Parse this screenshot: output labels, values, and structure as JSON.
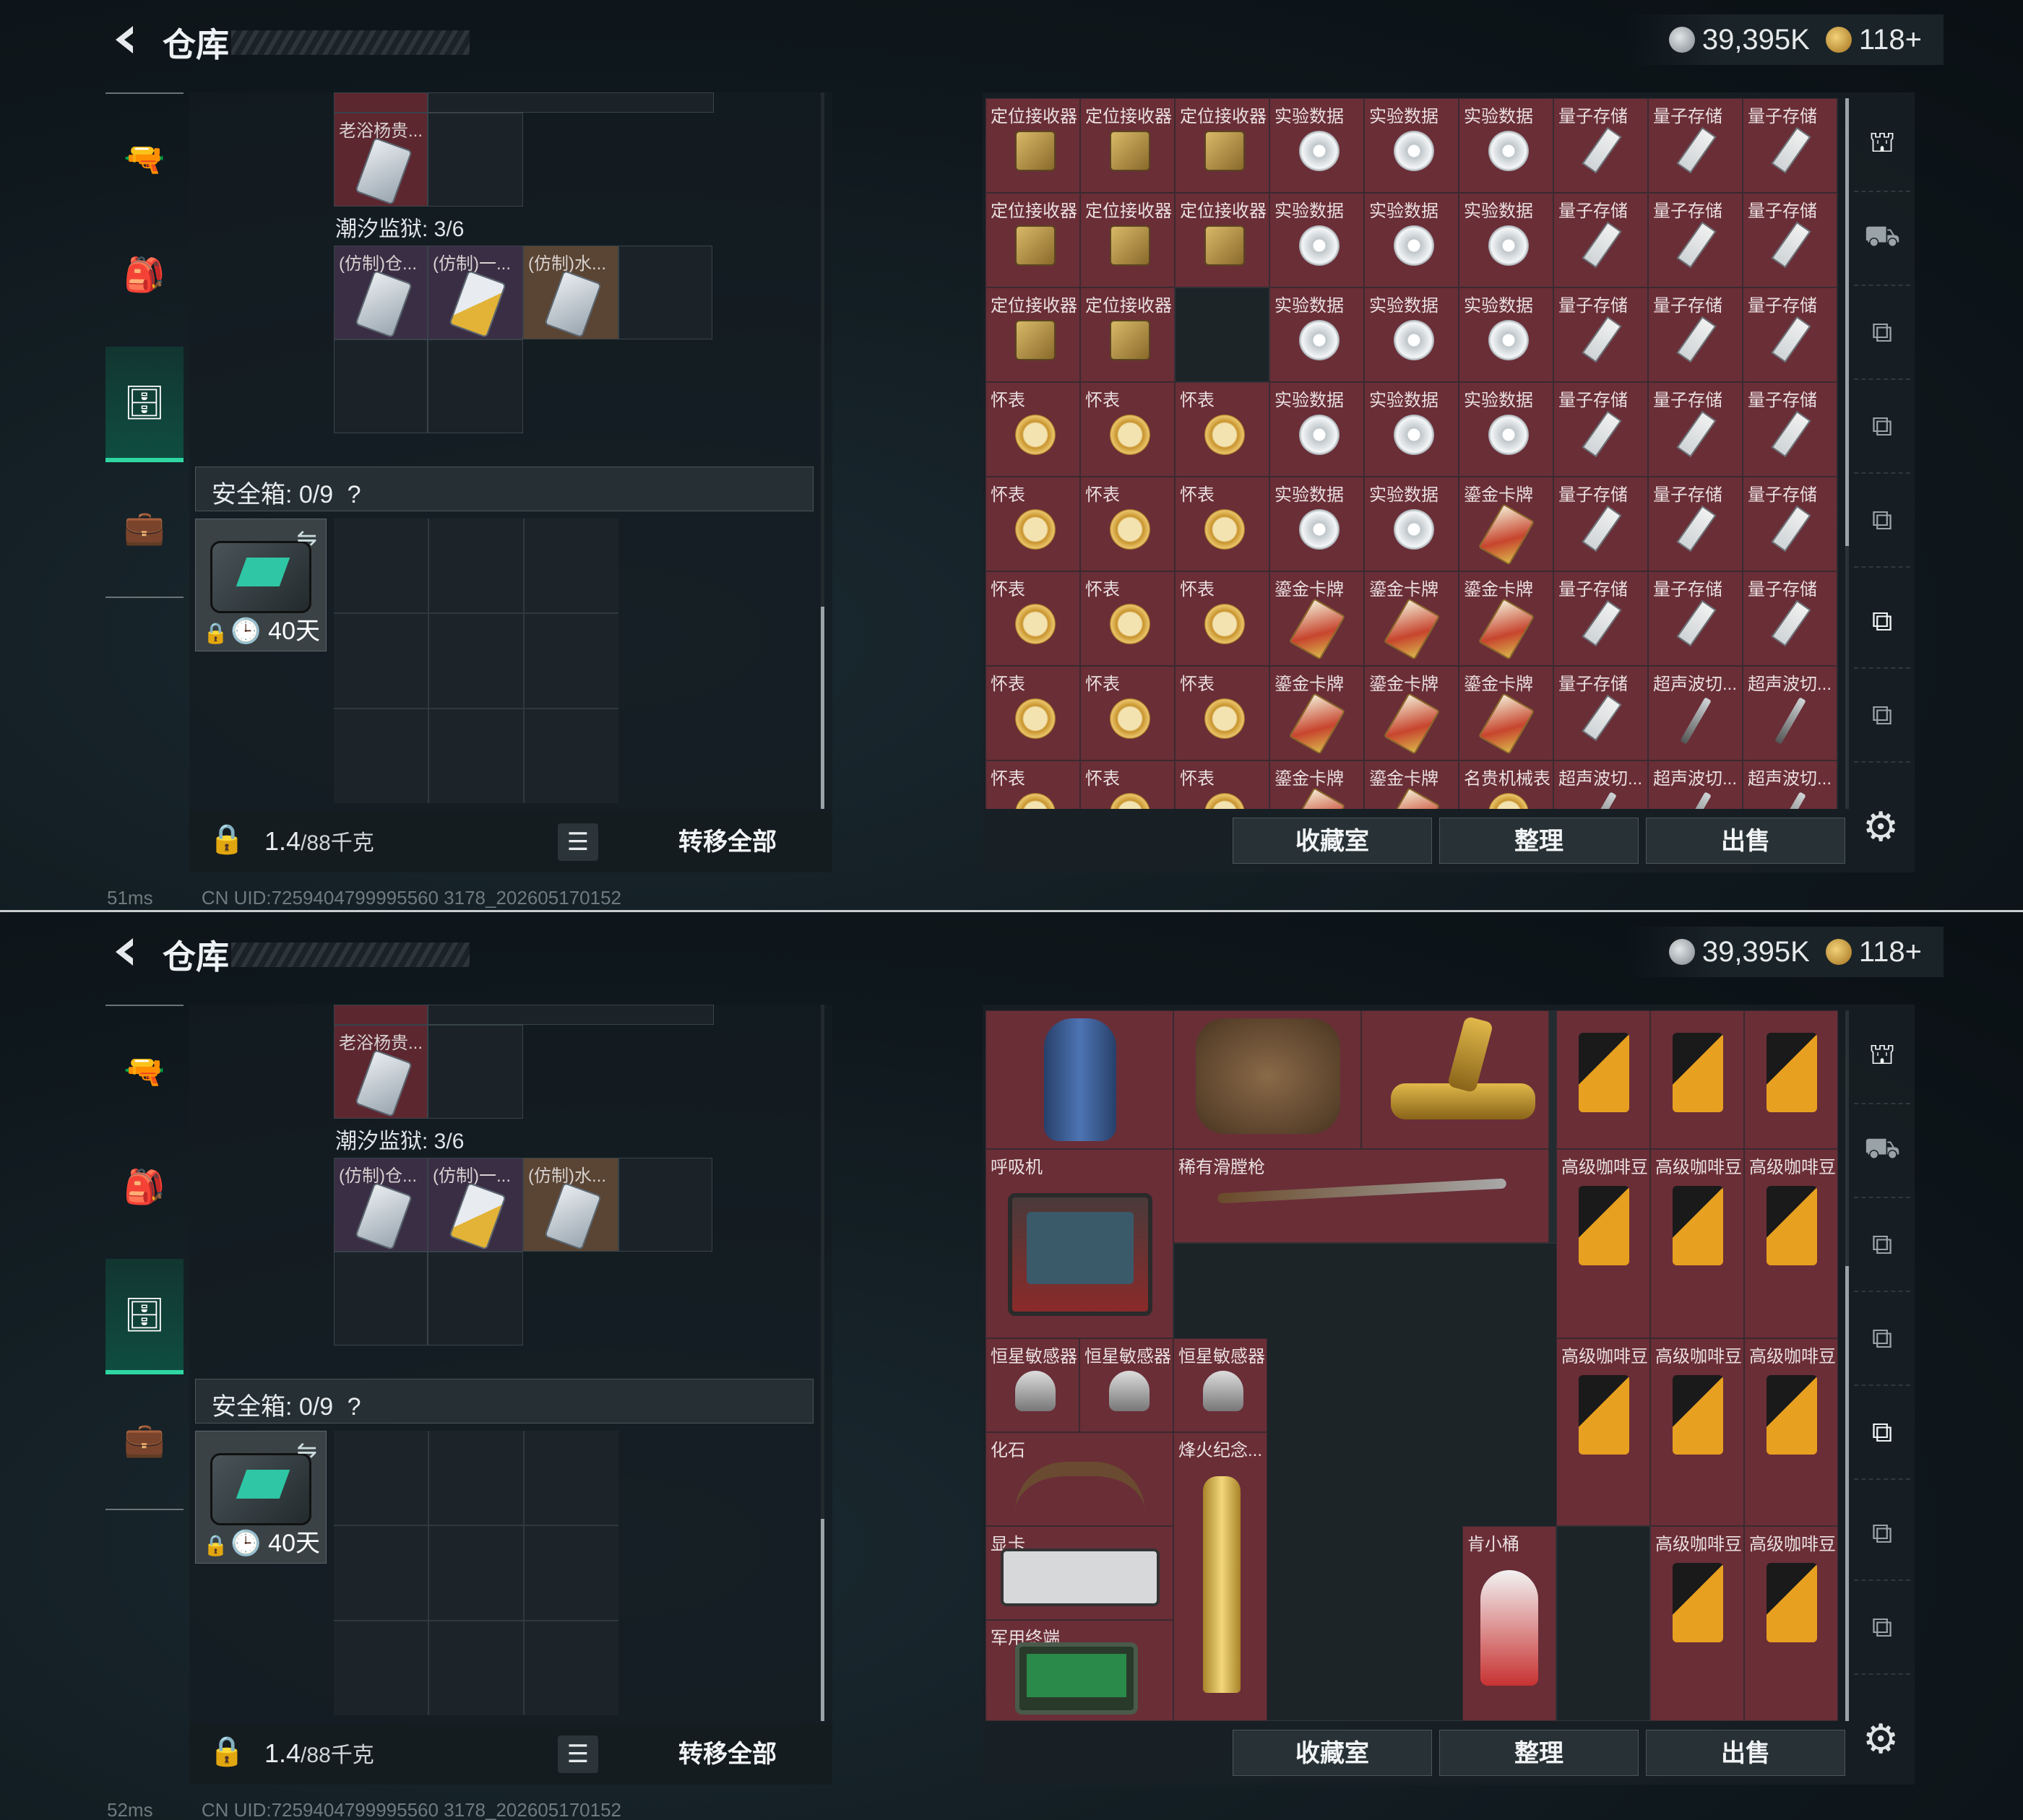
{
  "screens": [
    {
      "header": {
        "title": "仓库"
      },
      "currency": {
        "silver": "39,395K",
        "gold": "118+"
      },
      "left": {
        "top_item_label": "老浴杨贵...",
        "section_label": "潮汐监狱: 3/6",
        "slots": [
          "(仿制)仓...",
          "(仿制)一...",
          "(仿制)水..."
        ],
        "safe_label": "安全箱: 0/9",
        "safe_help": "?",
        "safe_days": "40天",
        "weight": "1.4",
        "weight_max": "/88千克",
        "transfer": "转移全部"
      },
      "actions": {
        "collection": "收藏室",
        "sort": "整理",
        "sell": "出售"
      },
      "status": {
        "ping": "51ms",
        "uid": "CN UID:7259404799995560 3178_202605170152"
      }
    },
    {
      "header": {
        "title": "仓库"
      },
      "currency": {
        "silver": "39,395K",
        "gold": "118+"
      },
      "left": {
        "top_item_label": "老浴杨贵...",
        "section_label": "潮汐监狱: 3/6",
        "slots": [
          "(仿制)仓...",
          "(仿制)一...",
          "(仿制)水..."
        ],
        "safe_label": "安全箱: 0/9",
        "safe_help": "?",
        "safe_days": "40天",
        "weight": "1.4",
        "weight_max": "/88千克",
        "transfer": "转移全部"
      },
      "actions": {
        "collection": "收藏室",
        "sort": "整理",
        "sell": "出售"
      },
      "status": {
        "ping": "52ms",
        "uid": "CN UID:7259404799995560 3178_202605170152"
      }
    }
  ],
  "inventory_1": [
    [
      "定位接收器",
      "定位接收器",
      "定位接收器",
      "实验数据",
      "实验数据",
      "实验数据",
      "量子存储",
      "量子存储",
      "量子存储"
    ],
    [
      "定位接收器",
      "定位接收器",
      "定位接收器",
      "实验数据",
      "实验数据",
      "实验数据",
      "量子存储",
      "量子存储",
      "量子存储"
    ],
    [
      "定位接收器",
      "定位接收器",
      "",
      "实验数据",
      "实验数据",
      "实验数据",
      "量子存储",
      "量子存储",
      "量子存储"
    ],
    [
      "怀表",
      "怀表",
      "怀表",
      "实验数据",
      "实验数据",
      "实验数据",
      "量子存储",
      "量子存储",
      "量子存储"
    ],
    [
      "怀表",
      "怀表",
      "怀表",
      "实验数据",
      "实验数据",
      "鎏金卡牌",
      "量子存储",
      "量子存储",
      "量子存储"
    ],
    [
      "怀表",
      "怀表",
      "怀表",
      "鎏金卡牌",
      "鎏金卡牌",
      "鎏金卡牌",
      "量子存储",
      "量子存储",
      "量子存储"
    ],
    [
      "怀表",
      "怀表",
      "怀表",
      "鎏金卡牌",
      "鎏金卡牌",
      "鎏金卡牌",
      "量子存储",
      "超声波切...",
      "超声波切..."
    ],
    [
      "怀表",
      "怀表",
      "怀表",
      "鎏金卡牌",
      "鎏金卡牌",
      "名贵机械表",
      "超声波切...",
      "超声波切...",
      "超声波切..."
    ]
  ],
  "inventory_2": {
    "big_items": [
      {
        "label": "呼吸机"
      },
      {
        "label": "稀有滑膛枪"
      },
      {
        "label": "化石"
      },
      {
        "label": "烽火纪念..."
      },
      {
        "label": "显卡"
      },
      {
        "label": "肯小桶"
      },
      {
        "label": "军用终端"
      }
    ],
    "sensor": "恒星敏感器",
    "coffee": "高级咖啡豆"
  },
  "icons": {
    "back": "back-arrow-icon",
    "nav": [
      "pistol-icon",
      "backpack-icon",
      "storage-icon",
      "briefcase-icon"
    ],
    "right_nav": [
      "vault-icon",
      "gt-icon",
      "cam-icon",
      "cam-icon",
      "cam-icon",
      "cam-icon",
      "cam-icon"
    ]
  },
  "colors": {
    "accent": "#2fd6a2",
    "item_red": "#6a2e37"
  }
}
